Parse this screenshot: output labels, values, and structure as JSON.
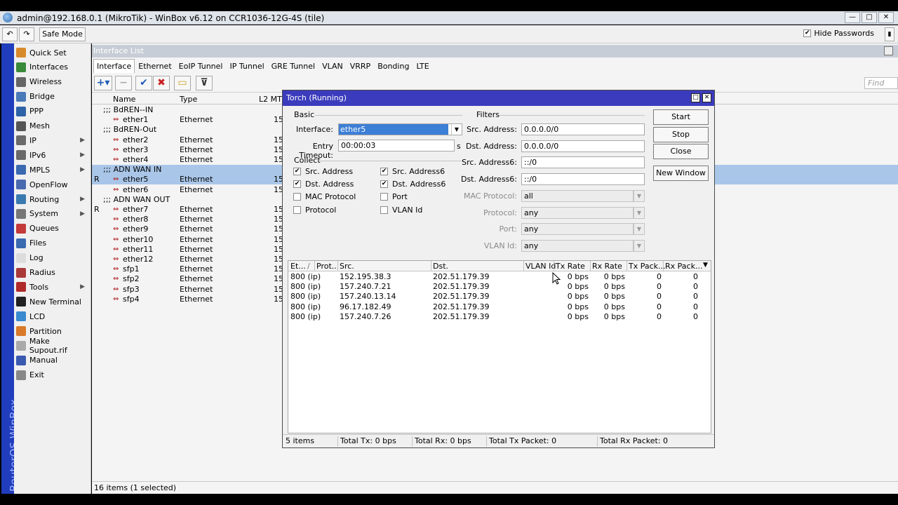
{
  "window": {
    "title": "admin@192.168.0.1 (MikroTik) - WinBox v6.12 on CCR1036-12G-4S (tile)"
  },
  "toolbar": {
    "undo": "↶",
    "redo": "↷",
    "safe_mode": "Safe Mode",
    "hide_passwords": "Hide Passwords",
    "hide_passwords_checked": true
  },
  "brand": {
    "vertical_text": "RouterOS WinBox"
  },
  "sidebar": {
    "items": [
      {
        "label": "Quick Set",
        "icon": "quick-set-icon",
        "color": "#d88a2a"
      },
      {
        "label": "Interfaces",
        "icon": "interfaces-icon",
        "color": "#3a8a3a"
      },
      {
        "label": "Wireless",
        "icon": "wireless-icon",
        "color": "#666666"
      },
      {
        "label": "Bridge",
        "icon": "bridge-icon",
        "color": "#4a7ab8"
      },
      {
        "label": "PPP",
        "icon": "ppp-icon",
        "color": "#2f63a8"
      },
      {
        "label": "Mesh",
        "icon": "mesh-icon",
        "color": "#555555"
      },
      {
        "label": "IP",
        "icon": "ip-icon",
        "color": "#6a6a6a",
        "submenu": true
      },
      {
        "label": "IPv6",
        "icon": "ipv6-icon",
        "color": "#6a6a6a",
        "submenu": true
      },
      {
        "label": "MPLS",
        "icon": "mpls-icon",
        "color": "#3a6ab0",
        "submenu": true
      },
      {
        "label": "OpenFlow",
        "icon": "openflow-icon",
        "color": "#4a6ab0"
      },
      {
        "label": "Routing",
        "icon": "routing-icon",
        "color": "#3a7ab0",
        "submenu": true
      },
      {
        "label": "System",
        "icon": "system-icon",
        "color": "#777777",
        "submenu": true
      },
      {
        "label": "Queues",
        "icon": "queues-icon",
        "color": "#c43a3a"
      },
      {
        "label": "Files",
        "icon": "files-icon",
        "color": "#3a6ab0"
      },
      {
        "label": "Log",
        "icon": "log-icon",
        "color": "#dcdcdc"
      },
      {
        "label": "Radius",
        "icon": "radius-icon",
        "color": "#a83a3a"
      },
      {
        "label": "Tools",
        "icon": "tools-icon",
        "color": "#b02a2a",
        "submenu": true
      },
      {
        "label": "New Terminal",
        "icon": "terminal-icon",
        "color": "#222222"
      },
      {
        "label": "LCD",
        "icon": "lcd-icon",
        "color": "#3a8ad0"
      },
      {
        "label": "Partition",
        "icon": "partition-icon",
        "color": "#d87a2a"
      },
      {
        "label": "Make Supout.rif",
        "icon": "supout-icon",
        "color": "#aaaaaa"
      },
      {
        "label": "Manual",
        "icon": "manual-icon",
        "color": "#3a5ab0"
      },
      {
        "label": "Exit",
        "icon": "exit-icon",
        "color": "#888888"
      }
    ]
  },
  "interface_list": {
    "title": "Interface List",
    "tabs": [
      "Interface",
      "Ethernet",
      "EoIP Tunnel",
      "IP Tunnel",
      "GRE Tunnel",
      "VLAN",
      "VRRP",
      "Bonding",
      "LTE"
    ],
    "find_placeholder": "Find",
    "columns": [
      "Name",
      "Type",
      "L2 MTU"
    ],
    "rows": [
      {
        "flag": "",
        "name": ";;; BdREN--IN",
        "type": "",
        "mtu": "",
        "comment": true
      },
      {
        "flag": "",
        "name": "ether1",
        "type": "Ethernet",
        "mtu": "15"
      },
      {
        "flag": "",
        "name": ";;; BdREN-Out",
        "type": "",
        "mtu": "",
        "comment": true
      },
      {
        "flag": "",
        "name": "ether2",
        "type": "Ethernet",
        "mtu": "15"
      },
      {
        "flag": "",
        "name": "ether3",
        "type": "Ethernet",
        "mtu": "15"
      },
      {
        "flag": "",
        "name": "ether4",
        "type": "Ethernet",
        "mtu": "15"
      },
      {
        "flag": "",
        "name": ";;; ADN WAN IN",
        "type": "",
        "mtu": "",
        "comment": true,
        "selected": true
      },
      {
        "flag": "R",
        "name": "ether5",
        "type": "Ethernet",
        "mtu": "15",
        "selected": true
      },
      {
        "flag": "",
        "name": "ether6",
        "type": "Ethernet",
        "mtu": "15"
      },
      {
        "flag": "",
        "name": ";;; ADN WAN OUT",
        "type": "",
        "mtu": "",
        "comment": true
      },
      {
        "flag": "R",
        "name": "ether7",
        "type": "Ethernet",
        "mtu": "15"
      },
      {
        "flag": "",
        "name": "ether8",
        "type": "Ethernet",
        "mtu": "15"
      },
      {
        "flag": "",
        "name": "ether9",
        "type": "Ethernet",
        "mtu": "15"
      },
      {
        "flag": "",
        "name": "ether10",
        "type": "Ethernet",
        "mtu": "15"
      },
      {
        "flag": "",
        "name": "ether11",
        "type": "Ethernet",
        "mtu": "15"
      },
      {
        "flag": "",
        "name": "ether12",
        "type": "Ethernet",
        "mtu": "15"
      },
      {
        "flag": "",
        "name": "sfp1",
        "type": "Ethernet",
        "mtu": "15"
      },
      {
        "flag": "",
        "name": "sfp2",
        "type": "Ethernet",
        "mtu": "15"
      },
      {
        "flag": "",
        "name": "sfp3",
        "type": "Ethernet",
        "mtu": "15"
      },
      {
        "flag": "",
        "name": "sfp4",
        "type": "Ethernet",
        "mtu": "15"
      }
    ],
    "status": "16 items (1 selected)"
  },
  "torch": {
    "title": "Torch (Running)",
    "basic_label": "Basic",
    "filters_label": "Filters",
    "collect_label": "Collect",
    "interface_label": "Interface:",
    "interface_value": "ether5",
    "entry_timeout_label": "Entry Timeout:",
    "entry_timeout_value": "00:00:03",
    "entry_timeout_unit": "s",
    "collect": [
      {
        "label": "Src. Address",
        "checked": true
      },
      {
        "label": "Src. Address6",
        "checked": true
      },
      {
        "label": "Dst. Address",
        "checked": true
      },
      {
        "label": "Dst. Address6",
        "checked": true
      },
      {
        "label": "MAC Protocol",
        "checked": false
      },
      {
        "label": "Port",
        "checked": false
      },
      {
        "label": "Protocol",
        "checked": false
      },
      {
        "label": "VLAN Id",
        "checked": false
      }
    ],
    "filters": [
      {
        "label": "Src. Address:",
        "value": "0.0.0.0/0",
        "disabled": false
      },
      {
        "label": "Dst. Address:",
        "value": "0.0.0.0/0",
        "disabled": false
      },
      {
        "label": "Src. Address6:",
        "value": "::/0",
        "disabled": false
      },
      {
        "label": "Dst. Address6:",
        "value": "::/0",
        "disabled": false
      },
      {
        "label": "MAC Protocol:",
        "value": "all",
        "disabled": true
      },
      {
        "label": "Protocol:",
        "value": "any",
        "disabled": true
      },
      {
        "label": "Port:",
        "value": "any",
        "disabled": true
      },
      {
        "label": "VLAN Id:",
        "value": "any",
        "disabled": true
      }
    ],
    "buttons": {
      "start": "Start",
      "stop": "Stop",
      "close": "Close",
      "new_window": "New Window"
    },
    "columns": [
      "Et...",
      "Prot...",
      "Src.",
      "Dst.",
      "VLAN Id",
      "Tx Rate",
      "Rx Rate",
      "Tx Pack...",
      "Rx Pack..."
    ],
    "rows": [
      [
        "800 (ip)",
        "",
        "152.195.38.3",
        "202.51.179.39",
        "",
        "0 bps",
        "0 bps",
        "0",
        "0"
      ],
      [
        "800 (ip)",
        "",
        "157.240.7.21",
        "202.51.179.39",
        "",
        "0 bps",
        "0 bps",
        "0",
        "0"
      ],
      [
        "800 (ip)",
        "",
        "157.240.13.14",
        "202.51.179.39",
        "",
        "0 bps",
        "0 bps",
        "0",
        "0"
      ],
      [
        "800 (ip)",
        "",
        "96.17.182.49",
        "202.51.179.39",
        "",
        "0 bps",
        "0 bps",
        "0",
        "0"
      ],
      [
        "800 (ip)",
        "",
        "157.240.7.26",
        "202.51.179.39",
        "",
        "0 bps",
        "0 bps",
        "0",
        "0"
      ]
    ],
    "status": {
      "items": "5 items",
      "total_tx": "Total Tx: 0 bps",
      "total_rx": "Total Rx: 0 bps",
      "total_tx_packet": "Total Tx Packet: 0",
      "total_rx_packet": "Total Rx Packet: 0"
    }
  }
}
